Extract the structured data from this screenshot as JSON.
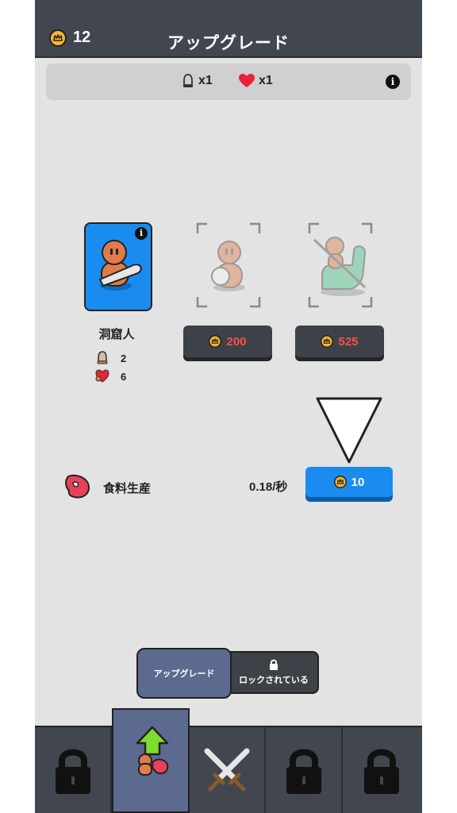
{
  "header": {
    "coins": "12",
    "title": "アップグレード"
  },
  "multipliers": {
    "attack": "x1",
    "health": "x1"
  },
  "units": [
    {
      "name": "洞窟人",
      "attack": "2",
      "health": "6",
      "state": "owned"
    },
    {
      "price": "200",
      "state": "locked"
    },
    {
      "price": "525",
      "state": "locked"
    }
  ],
  "food": {
    "label": "食料生産",
    "rate": "0.18/秒",
    "cost": "10"
  },
  "toggle": {
    "active_label": "アップグレード",
    "locked_label": "ロックされている"
  },
  "nav": {
    "tabs": [
      "lock-icon",
      "upgrade-icon",
      "swords-icon",
      "lock-icon",
      "lock-icon"
    ],
    "active_index": 1
  },
  "colors": {
    "accent_blue": "#1a8cf0",
    "topbar": "#42464f",
    "price_red": "#ff4d4d",
    "coin_gold": "#f7b731"
  }
}
